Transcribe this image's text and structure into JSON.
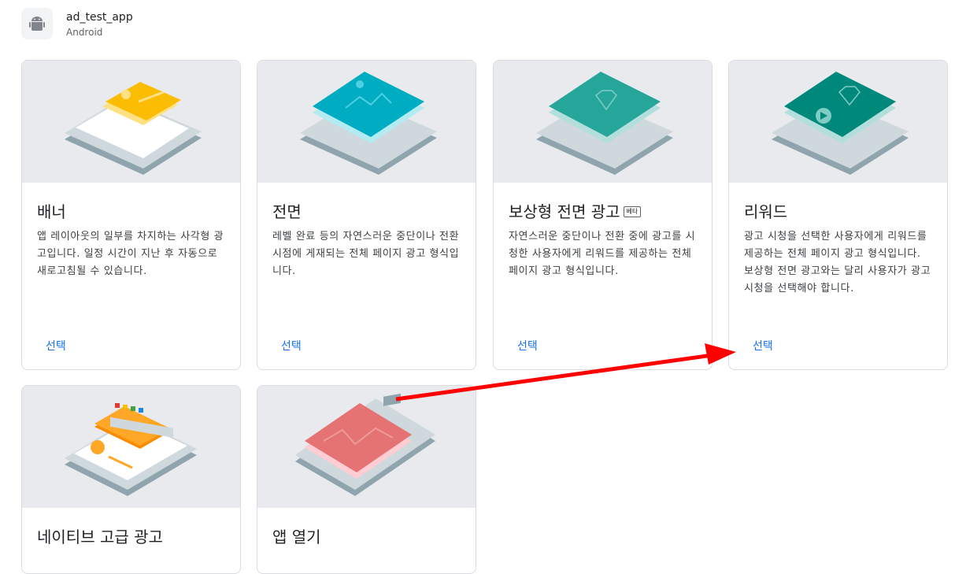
{
  "app": {
    "name": "ad_test_app",
    "platform": "Android"
  },
  "cards": [
    {
      "title": "배너",
      "badge": "",
      "desc": "앱 레이아웃의 일부를 차지하는 사각형 광고입니다. 일정 시간이 지난 후 자동으로 새로고침될 수 있습니다.",
      "select": "선택"
    },
    {
      "title": "전면",
      "badge": "",
      "desc": "레벨 완료 등의 자연스러운 중단이나 전환 시점에 게재되는 전체 페이지 광고 형식입니다.",
      "select": "선택"
    },
    {
      "title": "보상형 전면 광고",
      "badge": "베타",
      "desc": "자연스러운 중단이나 전환 중에 광고를 시청한 사용자에게 리워드를 제공하는 전체 페이지 광고 형식입니다.",
      "select": "선택"
    },
    {
      "title": "리워드",
      "badge": "",
      "desc": "광고 시청을 선택한 사용자에게 리워드를 제공하는 전체 페이지 광고 형식입니다. 보상형 전면 광고와는 달리 사용자가 광고 시청을 선택해야 합니다.",
      "select": "선택"
    },
    {
      "title": "네이티브 고급 광고",
      "badge": "",
      "desc": "",
      "select": ""
    },
    {
      "title": "앱 열기",
      "badge": "",
      "desc": "",
      "select": ""
    }
  ],
  "colors": {
    "accent": "#1a73e8",
    "annotation_arrow": "#ff0000",
    "banner": "#fbbc04",
    "interstitial": "#00acc1",
    "rewarded_interstitial": "#26a69a",
    "rewarded": "#00897b",
    "native": "#fb8c00",
    "app_open": "#e57373"
  }
}
